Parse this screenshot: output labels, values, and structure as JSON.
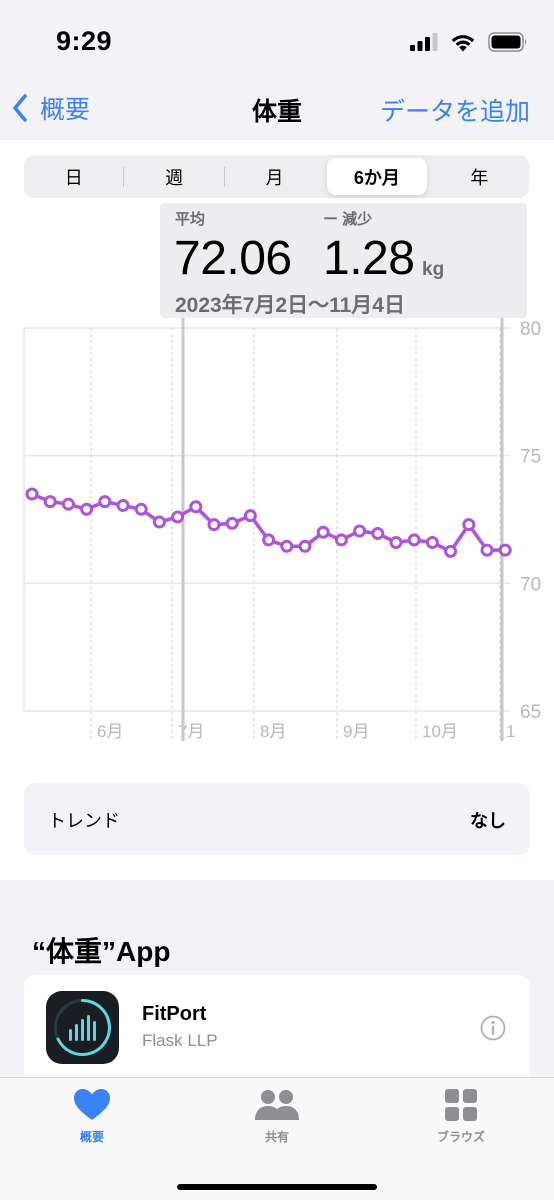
{
  "status_bar": {
    "time": "9:29"
  },
  "nav": {
    "back_label": "概要",
    "title": "体重",
    "add_label": "データを追加"
  },
  "segments": {
    "items": [
      "日",
      "週",
      "月",
      "6か月",
      "年"
    ],
    "selected": "6か月"
  },
  "summary": {
    "avg_label": "平均",
    "avg_value": "72.06",
    "change_label": "ー 減少",
    "change_value": "1.28",
    "unit": "kg",
    "date_range": "2023年7月2日〜11月4日"
  },
  "chart_data": {
    "type": "line",
    "x": [
      0,
      1,
      2,
      3,
      4,
      5,
      6,
      7,
      8,
      9,
      10,
      11,
      12,
      13,
      14,
      15,
      16,
      17,
      18,
      19,
      20,
      21,
      22,
      23,
      24,
      25,
      26
    ],
    "values": [
      73.5,
      73.2,
      73.1,
      72.9,
      73.2,
      73.05,
      72.9,
      72.4,
      72.6,
      73.0,
      72.3,
      72.35,
      72.65,
      71.7,
      71.45,
      71.45,
      72.0,
      71.7,
      72.05,
      71.95,
      71.6,
      71.7,
      71.6,
      71.25,
      72.3,
      71.3,
      71.3
    ],
    "y_ticks": [
      "80",
      "75",
      "70",
      "65"
    ],
    "ylim": [
      65,
      80
    ],
    "x_labels": [
      "6月",
      "7月",
      "8月",
      "9月",
      "10月",
      "1"
    ],
    "line_color": "#af52de",
    "grid": true
  },
  "trend": {
    "label": "トレンド",
    "value": "なし"
  },
  "apps_section": {
    "title": "“体重”App",
    "app": {
      "name": "FitPort",
      "developer": "Flask LLP"
    }
  },
  "tab_bar": {
    "items": [
      {
        "label": "概要",
        "icon": "heart-icon",
        "active": true
      },
      {
        "label": "共有",
        "icon": "people-icon",
        "active": false
      },
      {
        "label": "ブラウズ",
        "icon": "grid-icon",
        "active": false
      }
    ]
  },
  "colors": {
    "accent": "#3a82f7",
    "chart": "#af52de"
  }
}
